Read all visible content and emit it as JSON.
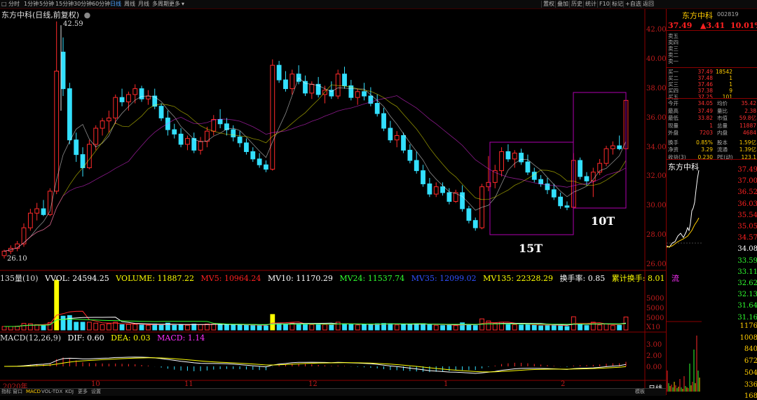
{
  "toolbar": {
    "periods": [
      "分时",
      "1分钟",
      "5分钟",
      "15分钟",
      "30分钟",
      "60分钟",
      "日线",
      "周线",
      "月线",
      "多周期",
      "更多"
    ],
    "active_period": "日线",
    "tools": [
      "置权",
      "叠加",
      "历史",
      "统计",
      "F10",
      "标记",
      "+自选",
      "返回"
    ]
  },
  "chart": {
    "title": "东方中科(日线,前复权)",
    "high_label": "42.59",
    "low_label": "26.10",
    "y_axis": [
      "42.00",
      "40.00",
      "38.00",
      "36.00",
      "34.00",
      "32.00",
      "30.00",
      "28.00",
      "26.00"
    ],
    "box1_label": "15T",
    "box2_label": "10T",
    "candles": [
      [
        26.6,
        27.0,
        26.4,
        26.9
      ],
      [
        26.9,
        27.3,
        26.7,
        27.1
      ],
      [
        27.1,
        27.6,
        26.9,
        27.4
      ],
      [
        27.4,
        28.8,
        27.2,
        28.5
      ],
      [
        28.5,
        29.8,
        28.3,
        29.5
      ],
      [
        29.5,
        30.2,
        29.0,
        29.8
      ],
      [
        29.8,
        30.4,
        29.3,
        29.4
      ],
      [
        29.4,
        31.2,
        29.3,
        31.0
      ],
      [
        31.0,
        42.59,
        30.8,
        39.2
      ],
      [
        40.5,
        41.5,
        37.5,
        38.0
      ],
      [
        38.0,
        38.4,
        34.2,
        34.5
      ],
      [
        34.5,
        35.0,
        33.0,
        33.5
      ],
      [
        33.5,
        34.0,
        32.0,
        32.6
      ],
      [
        32.6,
        34.5,
        32.5,
        34.2
      ],
      [
        34.2,
        35.5,
        33.8,
        35.3
      ],
      [
        35.3,
        36.0,
        34.8,
        35.8
      ],
      [
        35.8,
        36.5,
        35.0,
        36.0
      ],
      [
        36.0,
        37.6,
        35.6,
        37.4
      ],
      [
        37.4,
        38.0,
        36.8,
        37.1
      ],
      [
        37.1,
        37.8,
        36.5,
        37.6
      ],
      [
        37.6,
        38.3,
        37.0,
        38.0
      ],
      [
        38.0,
        38.2,
        37.1,
        37.3
      ],
      [
        37.3,
        37.9,
        36.9,
        37.5
      ],
      [
        37.5,
        38.0,
        36.6,
        36.8
      ],
      [
        36.8,
        37.0,
        35.8,
        36.0
      ],
      [
        36.0,
        36.5,
        34.8,
        35.2
      ],
      [
        35.2,
        35.6,
        34.6,
        34.9
      ],
      [
        34.9,
        35.3,
        34.0,
        34.2
      ],
      [
        34.2,
        34.8,
        33.8,
        34.6
      ],
      [
        34.6,
        35.0,
        33.6,
        33.8
      ],
      [
        33.8,
        34.7,
        33.5,
        34.4
      ],
      [
        34.4,
        35.4,
        34.0,
        35.1
      ],
      [
        35.1,
        36.2,
        34.8,
        35.9
      ],
      [
        35.9,
        36.6,
        35.3,
        35.6
      ],
      [
        35.6,
        36.0,
        34.8,
        35.2
      ],
      [
        35.2,
        35.5,
        34.4,
        34.7
      ],
      [
        34.7,
        35.1,
        34.0,
        34.3
      ],
      [
        34.3,
        34.6,
        33.5,
        33.7
      ],
      [
        33.7,
        34.0,
        33.0,
        33.2
      ],
      [
        33.2,
        33.6,
        32.6,
        32.8
      ],
      [
        32.8,
        33.1,
        32.3,
        32.5
      ],
      [
        32.5,
        40.0,
        32.4,
        39.6
      ],
      [
        39.6,
        39.9,
        38.4,
        38.6
      ],
      [
        38.6,
        39.2,
        37.8,
        38.0
      ],
      [
        38.0,
        39.3,
        37.6,
        39.0
      ],
      [
        39.0,
        39.6,
        38.3,
        38.5
      ],
      [
        38.5,
        38.9,
        37.5,
        37.7
      ],
      [
        37.7,
        38.5,
        37.3,
        38.3
      ],
      [
        38.3,
        38.8,
        37.4,
        37.6
      ],
      [
        37.6,
        38.2,
        37.0,
        37.9
      ],
      [
        37.9,
        38.5,
        37.3,
        37.5
      ],
      [
        37.5,
        39.3,
        37.3,
        39.0
      ],
      [
        39.0,
        39.5,
        38.0,
        38.2
      ],
      [
        38.2,
        38.6,
        37.2,
        37.4
      ],
      [
        37.4,
        38.0,
        36.9,
        37.8
      ],
      [
        37.8,
        38.4,
        37.2,
        37.5
      ],
      [
        37.5,
        38.1,
        36.8,
        37.0
      ],
      [
        37.0,
        37.6,
        36.1,
        36.3
      ],
      [
        36.3,
        36.7,
        35.1,
        35.3
      ],
      [
        35.3,
        35.8,
        34.3,
        34.5
      ],
      [
        34.5,
        35.1,
        34.0,
        34.8
      ],
      [
        34.8,
        35.0,
        33.6,
        33.8
      ],
      [
        33.8,
        34.2,
        32.9,
        33.1
      ],
      [
        33.1,
        33.7,
        32.2,
        32.4
      ],
      [
        32.4,
        32.8,
        31.3,
        31.5
      ],
      [
        31.5,
        31.9,
        30.6,
        30.8
      ],
      [
        30.8,
        31.6,
        30.6,
        31.3
      ],
      [
        31.3,
        31.6,
        30.7,
        30.9
      ],
      [
        30.9,
        31.2,
        30.1,
        30.3
      ],
      [
        30.3,
        31.1,
        30.2,
        30.9
      ],
      [
        30.9,
        31.4,
        29.6,
        29.8
      ],
      [
        29.8,
        30.0,
        28.8,
        29.0
      ],
      [
        29.0,
        29.2,
        28.3,
        28.5
      ],
      [
        28.5,
        31.5,
        28.4,
        31.3
      ],
      [
        31.3,
        33.4,
        31.0,
        31.6
      ],
      [
        31.6,
        32.8,
        31.2,
        32.4
      ],
      [
        32.4,
        34.0,
        32.0,
        33.7
      ],
      [
        33.7,
        34.2,
        33.0,
        33.2
      ],
      [
        33.2,
        33.8,
        32.6,
        33.6
      ],
      [
        33.6,
        33.9,
        32.8,
        33.0
      ],
      [
        33.0,
        33.5,
        32.1,
        32.3
      ],
      [
        32.3,
        32.6,
        31.6,
        31.8
      ],
      [
        31.8,
        32.1,
        31.3,
        31.5
      ],
      [
        31.5,
        31.9,
        30.8,
        31.1
      ],
      [
        31.1,
        31.5,
        30.4,
        30.6
      ],
      [
        30.6,
        30.9,
        29.8,
        30.0
      ],
      [
        30.0,
        30.3,
        29.7,
        29.9
      ],
      [
        29.9,
        33.6,
        29.8,
        33.1
      ],
      [
        33.1,
        33.3,
        31.8,
        32.0
      ],
      [
        32.0,
        32.3,
        31.4,
        31.7
      ],
      [
        31.7,
        32.6,
        30.6,
        32.3
      ],
      [
        32.3,
        33.2,
        32.1,
        32.9
      ],
      [
        32.9,
        34.1,
        32.7,
        33.9
      ],
      [
        33.9,
        34.4,
        33.5,
        34.1
      ],
      [
        34.1,
        34.8,
        33.8,
        33.9
      ],
      [
        33.9,
        37.6,
        33.9,
        37.2
      ]
    ]
  },
  "volume": {
    "name": "135量(10)",
    "vvol": "VVOL: 24594.25",
    "volume": "VOLUME: 11887.22",
    "mv5": "MV5: 10964.24",
    "mv10": "MV10: 11170.29",
    "mv24": "MV24: 11537.74",
    "mv35": "MV35: 12099.02",
    "mv135": "MV135: 22328.29",
    "turnover": "换手率: 0.85",
    "cum_turnover": "累计换手: 8.01",
    "trailing": "流",
    "axis": [
      "5000",
      "5000",
      "5000",
      "5000"
    ],
    "axis_unit": "X10"
  },
  "macd": {
    "name": "MACD(12,26,9)",
    "dif": "DIF: 0.60",
    "dea": "DEA: 0.03",
    "macd": "MACD: 1.14",
    "axis": [
      "3.00",
      "2.00",
      "1.00",
      "0.00"
    ]
  },
  "x_axis": [
    "2020年",
    "10",
    "11",
    "12",
    "1",
    "2"
  ],
  "right_panel": {
    "name": "东方中科",
    "code": "002819",
    "price": "37.49",
    "change": "▲3.41",
    "pct": "10.01%",
    "sells": [
      {
        "k": "卖五",
        "v": "",
        "n": ""
      },
      {
        "k": "卖四",
        "v": "",
        "n": ""
      },
      {
        "k": "卖三",
        "v": "",
        "n": ""
      },
      {
        "k": "卖二",
        "v": "",
        "n": ""
      },
      {
        "k": "卖一",
        "v": "",
        "n": ""
      }
    ],
    "buys": [
      {
        "k": "买一",
        "v": "37.49",
        "n": "18542"
      },
      {
        "k": "买二",
        "v": "37.48",
        "n": "1"
      },
      {
        "k": "买三",
        "v": "37.46",
        "n": "1"
      },
      {
        "k": "买四",
        "v": "37.38",
        "n": "9"
      },
      {
        "k": "买五",
        "v": "37.25",
        "n": "101"
      }
    ],
    "stats": [
      {
        "k": "今开",
        "v": "34.05",
        "k2": "均价",
        "v2": "35.42"
      },
      {
        "k": "最高",
        "v": "37.49",
        "k2": "量比",
        "v2": "2.38"
      },
      {
        "k": "最低",
        "v": "33.82",
        "k2": "市值",
        "v2": "59.8亿"
      },
      {
        "k": "现量",
        "v": "1",
        "k2": "总量",
        "v2": "11887"
      },
      {
        "k": "外盘",
        "v": "7203",
        "k2": "内盘",
        "v2": "4684"
      },
      {
        "k": "换手",
        "v": "0.85%",
        "k2": "股本",
        "v2": "1.59亿"
      },
      {
        "k": "净资",
        "v": "3.29",
        "k2": "流通",
        "v2": "1.39亿"
      },
      {
        "k": "收益(3)",
        "v": "0.230",
        "k2": "PE(动)",
        "v2": "123.1"
      }
    ],
    "mini_title": "东方中科",
    "mini_axis_price": [
      "37.49",
      "37.00",
      "36.52",
      "36.03",
      "35.54",
      "35.05",
      "34.57",
      "34.08",
      "33.59",
      "33.11",
      "32.62",
      "32.13",
      "31.64",
      "31.16"
    ],
    "mini_axis_vol": [
      "1176",
      "1008",
      "840",
      "672",
      "504",
      "336",
      "168"
    ],
    "mini_tab": "日线"
  },
  "bottom_tabs": [
    "指标",
    "窗口",
    "MACD",
    "VOL-TDX",
    "KDJ",
    "更多",
    "设置"
  ],
  "bottom_right": "模板"
}
